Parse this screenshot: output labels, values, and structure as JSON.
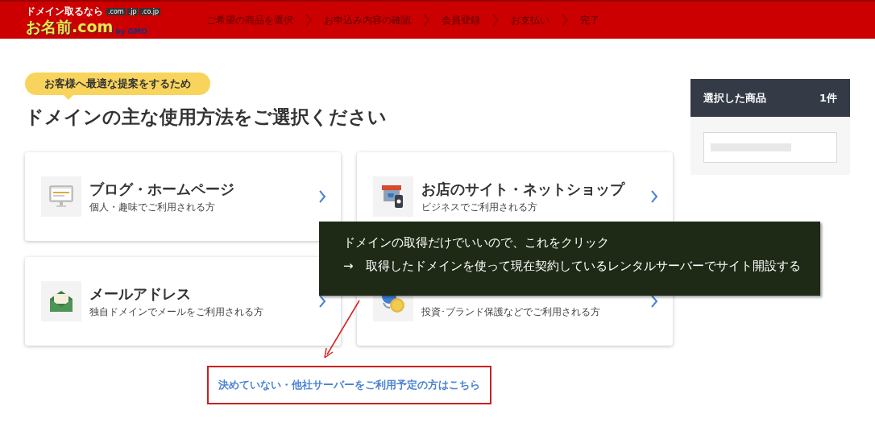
{
  "logo": {
    "tagline": "ドメイン取るなら",
    "name": "お名前.com",
    "tlds": [
      ".com",
      ".jp",
      ".co.jp"
    ],
    "by": "by GMO"
  },
  "steps": [
    {
      "label": "ご希望の商品を選択"
    },
    {
      "label": "お申込み内容の確認"
    },
    {
      "label": "会員登録"
    },
    {
      "label": "お支払い"
    },
    {
      "label": "完了"
    }
  ],
  "badge": "お客様へ最適な提案をするため",
  "heading": "ドメインの主な使用方法をご選択ください",
  "options": [
    {
      "kind": "monitor",
      "title": "ブログ・ホームページ",
      "subtitle": "個人・趣味でご利用される方"
    },
    {
      "kind": "shop",
      "title": "お店のサイト・ネットショップ",
      "subtitle": "ビジネスでご利用される方"
    },
    {
      "kind": "mail",
      "title": "メールアドレス",
      "subtitle": "独自ドメインでメールをご利用される方"
    },
    {
      "kind": "coin",
      "subtitle": "投資･ブランド保護などでご利用される方"
    }
  ],
  "other_link": "決めていない・他社サーバーをご利用予定の方はこちら",
  "cart": {
    "title": "選択した商品",
    "count": "1件"
  },
  "annotation": {
    "lines": [
      "ドメインの取得だけでいいので、これをクリック",
      "→　取得したドメインを使って現在契約しているレンタルサーバーでサイト開設する"
    ]
  }
}
